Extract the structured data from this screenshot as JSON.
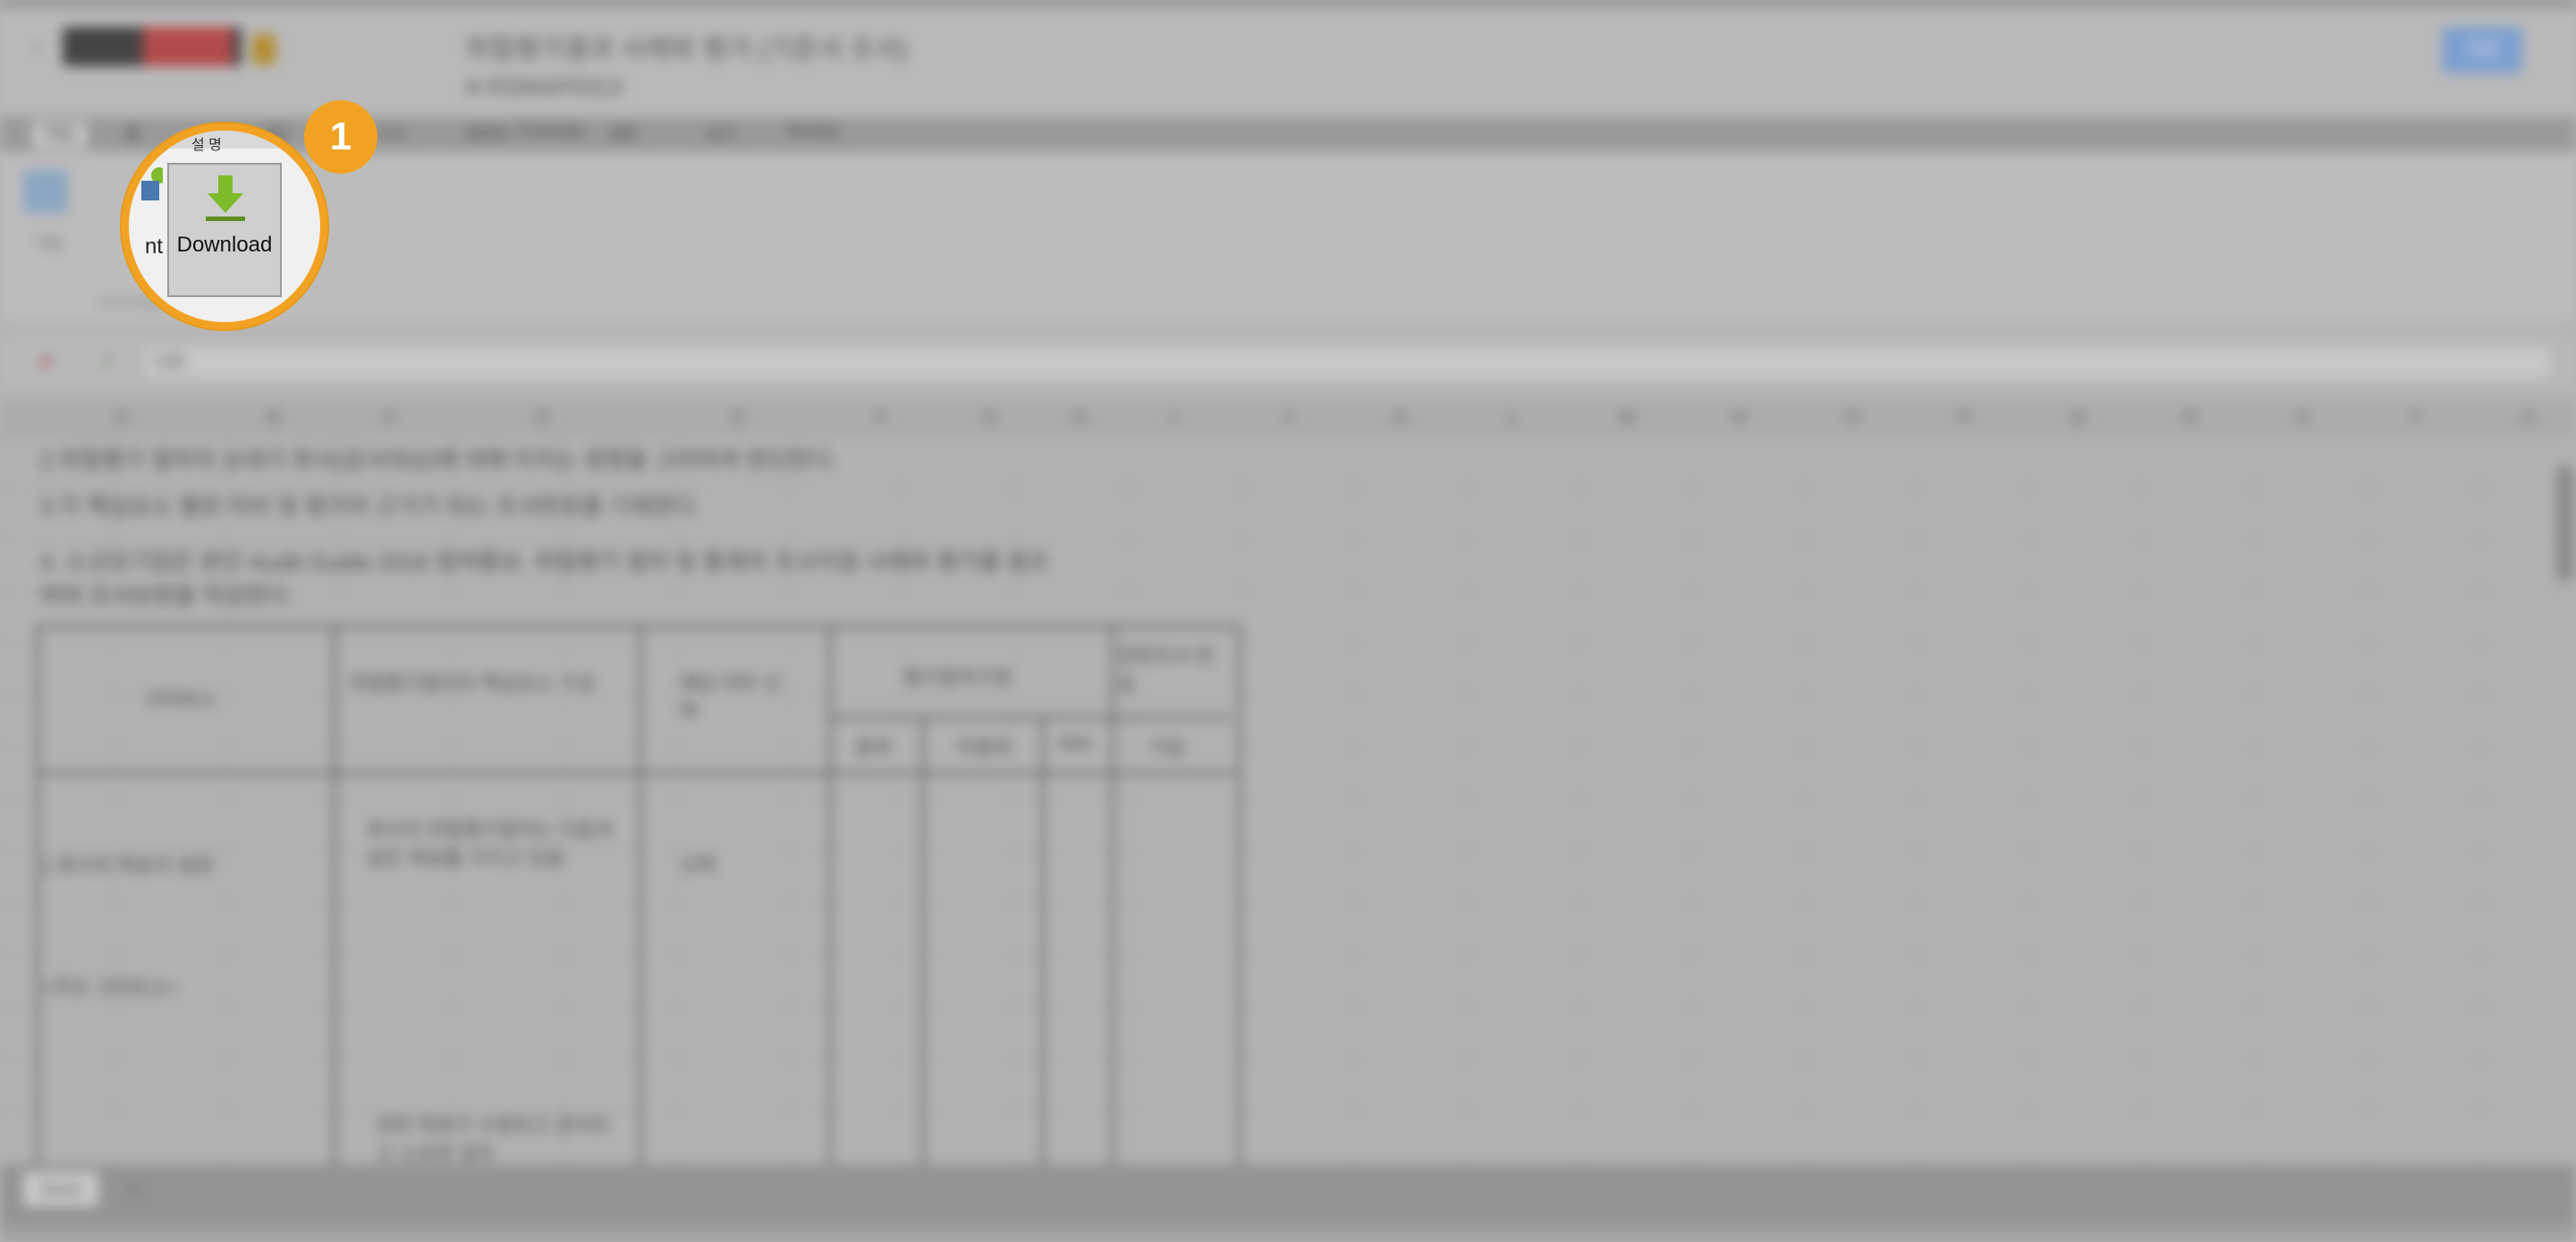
{
  "header": {
    "doc_title": "위험평가결과 사례와 평가 (기준서 조서)",
    "doc_code": "A-RSMAP0313",
    "top_button": "저장"
  },
  "ribbon_tabs": [
    "파일",
    "홈",
    "삽입",
    "수식",
    "데이터",
    "Formulas",
    "검토",
    "보기",
    "Review"
  ],
  "ribbon": {
    "first_label": "기능",
    "group_label": "Commands"
  },
  "formula": {
    "value": "1(9)"
  },
  "columns": [
    "A",
    "B",
    "C",
    "D",
    "E",
    "F",
    "G",
    "H",
    "I",
    "J",
    "K",
    "L",
    "M",
    "N",
    "O",
    "P",
    "Q",
    "R",
    "S",
    "T",
    "U"
  ],
  "sheet": {
    "lines": [
      "2.위험평가 절차의 상세가 회사(감사대상)에 대해 미치는 영향을 고려하여 판단한다.",
      "3.각 핵심요소 별로 미비 및 평가의 근거가 되는 조서번호를 기재한다.",
      "4. 소규모기업은 본인 Audit Guide 2016 참여통보, 위험평가 절차 및 통제의 조사지침 사례와 평가를 참조",
      "하여 조서보완을 작성한다."
    ],
    "table": {
      "h_area": "고려요소",
      "h_factor": "위험평가절차의 핵심요소 구성",
      "h_ref": "해당 여부 선택",
      "h_eval": "평가참여구분",
      "h_memo": "관련조서 번호",
      "sub_yes": "충족",
      "sub_no": "미충족",
      "sub_na": "N/A",
      "sub_memo": "기입",
      "row1_area": "1.회사의 목표의 설정",
      "row1_factor": "회사의 위험평가절차는 다음과 같은 목표를 가지고 있음",
      "row1_ref": "선택",
      "row2_area": "<주요 고려요소>",
      "row3_factor": "관련 목표가 수립되고 관리되고 소유한 경우"
    }
  },
  "bottom": {
    "sheet_tab": "Sheet",
    "add_sheet": "+"
  },
  "spotlight": {
    "ribbon_tab_text": "설 명",
    "prev_label": "nt",
    "download_label": "Download",
    "badge": "1"
  },
  "colors": {
    "highlight": "#f2a223",
    "download_arrow": "#7dbb2b"
  }
}
